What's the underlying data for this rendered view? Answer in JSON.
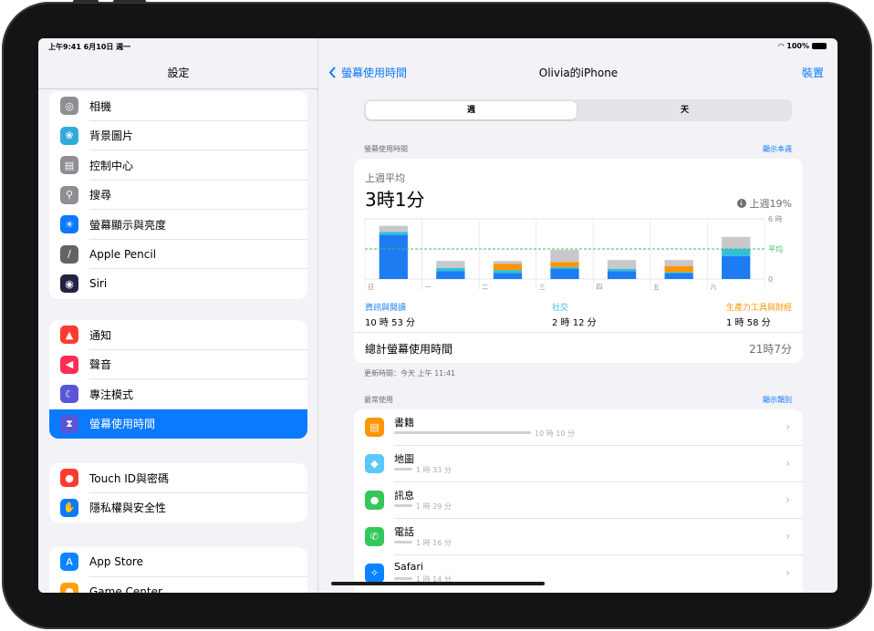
{
  "status_bar": {
    "time_date": "上午9:41  6月10日 週一",
    "battery": "100%"
  },
  "sidebar": {
    "title": "設定",
    "group1": [
      {
        "label": "相機",
        "icon": "camera-icon",
        "color": "#8e8e93",
        "glyph": "◎"
      },
      {
        "label": "背景圖片",
        "icon": "wallpaper-icon",
        "color": "#34aadc",
        "glyph": "❀"
      },
      {
        "label": "控制中心",
        "icon": "control-center-icon",
        "color": "#8e8e93",
        "glyph": "▤"
      },
      {
        "label": "搜尋",
        "icon": "search-icon",
        "color": "#8e8e93",
        "glyph": "⚲"
      },
      {
        "label": "螢幕顯示與亮度",
        "icon": "brightness-icon",
        "color": "#0a7aff",
        "glyph": "☀"
      },
      {
        "label": "Apple Pencil",
        "icon": "pencil-icon",
        "color": "#636366",
        "glyph": "/"
      },
      {
        "label": "Siri",
        "icon": "siri-icon",
        "color": "#222244",
        "glyph": "◉"
      }
    ],
    "group2": [
      {
        "label": "通知",
        "icon": "notifications-icon",
        "color": "#ff3b30",
        "glyph": "▲"
      },
      {
        "label": "聲音",
        "icon": "sound-icon",
        "color": "#ff2d55",
        "glyph": "◀"
      },
      {
        "label": "專注模式",
        "icon": "focus-moon-icon",
        "color": "#5856d6",
        "glyph": "☾"
      },
      {
        "label": "螢幕使用時間",
        "icon": "hourglass-icon",
        "color": "#5856d6",
        "glyph": "⧗",
        "selected": true
      }
    ],
    "group3": [
      {
        "label": "Touch ID與密碼",
        "icon": "fingerprint-lock-icon",
        "color": "#ff3b30",
        "glyph": "●"
      },
      {
        "label": "隱私權與安全性",
        "icon": "hand-icon",
        "color": "#0a7aff",
        "glyph": "✋"
      }
    ],
    "group4": [
      {
        "label": "App Store",
        "icon": "app-store-icon",
        "color": "#0a84ff",
        "glyph": "A"
      },
      {
        "label": "Game Center",
        "icon": "game-center-icon",
        "color": "#ff9f0a",
        "glyph": "●"
      }
    ]
  },
  "nav": {
    "back_label": "螢幕使用時間",
    "title": "Olivia的iPhone",
    "devices_label": "裝置"
  },
  "segment": {
    "week": "週",
    "day": "天",
    "selected": "week"
  },
  "screen_time": {
    "header": "螢幕使用時間",
    "link": "顯示本週",
    "subtitle": "上週平均",
    "value": "3時1分",
    "change": "上週19%",
    "ymax_label": "6 時",
    "avg_label": "平均",
    "zero_label": "0",
    "categories": [
      {
        "name": "資訊與閱讀",
        "time": "10 時 53 分",
        "color": "#1e7cf2"
      },
      {
        "name": "社交",
        "time": "2 時 12 分",
        "color": "#2ec0d8"
      },
      {
        "name": "生產力工具與財經",
        "time": "1 時 58 分",
        "color": "#ff9500"
      }
    ],
    "total_label": "總計螢幕使用時間",
    "total_value": "21時7分",
    "updated": "更新時間：今天 上午 11:41"
  },
  "chart_data": {
    "type": "bar",
    "stacked": true,
    "categories": [
      "日",
      "一",
      "二",
      "三",
      "四",
      "五",
      "六"
    ],
    "ylim": [
      0,
      6
    ],
    "y_unit": "時",
    "average": 3.0,
    "series": [
      {
        "name": "資訊與閱讀",
        "values": [
          4.4,
          0.8,
          0.6,
          1.0,
          0.8,
          0.6,
          2.3
        ],
        "color": "#1e7cf2"
      },
      {
        "name": "社交",
        "values": [
          0.3,
          0.3,
          0.3,
          0.2,
          0.2,
          0.1,
          0.7
        ],
        "color": "#2ec0d8"
      },
      {
        "name": "生產力工具與財經",
        "values": [
          0,
          0,
          0.6,
          0.5,
          0,
          0.6,
          0
        ],
        "color": "#ff9500"
      },
      {
        "values": [
          0.6,
          0.7,
          0.3,
          1.2,
          0.9,
          0.6,
          1.2
        ],
        "color": "#c7c7cc"
      }
    ]
  },
  "most_used": {
    "header": "最常使用",
    "link": "顯示類別",
    "apps": [
      {
        "name": "書籍",
        "time": "10 時 10 分",
        "icon": "books-icon",
        "color": "#ff9500",
        "glyph": "▤",
        "frac": 1.0
      },
      {
        "name": "地圖",
        "time": "1 時 33 分",
        "icon": "maps-icon",
        "color": "#5ac8fa",
        "glyph": "◆",
        "frac": 0.12
      },
      {
        "name": "訊息",
        "time": "1 時 29 分",
        "icon": "messages-icon",
        "color": "#34c759",
        "glyph": "●",
        "frac": 0.11
      },
      {
        "name": "電話",
        "time": "1 時 16 分",
        "icon": "phone-icon",
        "color": "#34c759",
        "glyph": "✆",
        "frac": 0.1
      },
      {
        "name": "Safari",
        "time": "1 時 14 分",
        "icon": "safari-icon",
        "color": "#0a84ff",
        "glyph": "✧",
        "frac": 0.1
      }
    ]
  }
}
